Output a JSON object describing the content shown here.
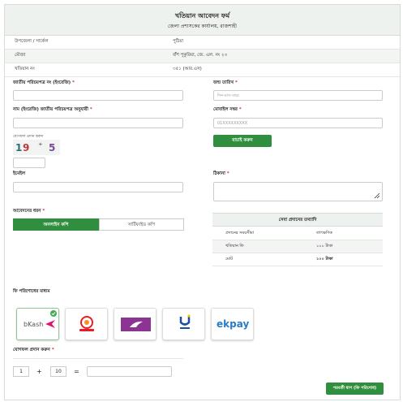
{
  "header": {
    "title": "খতিয়ান আবেদন ফর্ম",
    "subtitle": "জেলা প্রশাসকের কার্যালয়, রাজশাহী"
  },
  "info": {
    "upazila_label": "উপজেলা / সার্কেল",
    "upazila_value": "পুঠিয়া",
    "mouza_label": "মৌজা",
    "mouza_value": "বাঁশ পুকুরিয়া, জে. এল. নং ২৩",
    "khatian_label": "খতিয়ান নং",
    "khatian_value": "৩৫১ (আর.এস)"
  },
  "form": {
    "nid_en_label": "জাতীয় পরিচয়পত্র নং (ইংরেজি)",
    "dob_label": "জন্ম তারিখ",
    "dob_placeholder": "দিন-মাস-বছর",
    "name_label": "নাম (ইংরেজি) জাতীয় পরিচয়পত্র অনুযায়ী",
    "mobile_label": "মোবাইল নম্বর",
    "mobile_placeholder": "01XXXXXXXXX",
    "verify_button": "যাচাই করুন",
    "captcha_hint": "যোগফল প্রদান করুন",
    "captcha_chars": [
      "1",
      "9",
      "⁺",
      "5"
    ],
    "email_label": "ইমেইল",
    "address_label": "ঠিকানা",
    "delivery_label": "আবেদনের ধরন",
    "delivery_options": [
      "অনলাইন কপি",
      "সার্টিফাইড কপি"
    ],
    "delivery_selected": "অনলাইন কপি",
    "required_mark": "*"
  },
  "fee_table": {
    "title": "সেবা প্রদানের তথ্যাদি",
    "rows": [
      {
        "label": "প্রদানের সময়সীমা",
        "value": "তাৎক্ষণিক"
      },
      {
        "label": "খতিয়ান ফি",
        "value": "১০০ টাকা"
      },
      {
        "label": "মোট",
        "value": "১০০ টাকা"
      }
    ]
  },
  "payment": {
    "label": "ফি পরিশোধের মাধ্যম",
    "methods": [
      "bKash",
      "Nagad",
      "Rocket",
      "Upay",
      "ekpay"
    ],
    "selected": "bKash"
  },
  "captcha_sum": {
    "label": "যোগফল প্রদান করুন",
    "a": "1",
    "plus": "+",
    "b": "10",
    "equals": "="
  },
  "submit_button": "পরবর্তী ধাপ (ফি পরিশোধ)",
  "colors": {
    "accent": "#2f8f3e",
    "header_bg": "#eef2ee",
    "required": "#d9342b"
  }
}
